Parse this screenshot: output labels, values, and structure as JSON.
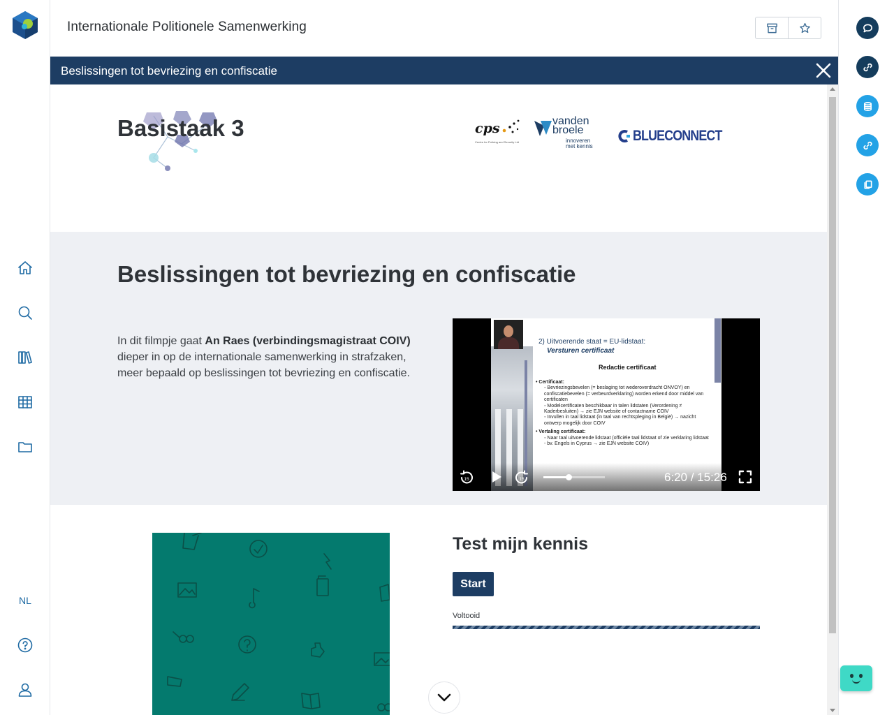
{
  "app": {
    "title": "Internationale Politionele Samenwerking"
  },
  "colors": {
    "navy": "#1d3d63",
    "accent_blue": "#1e6aa3",
    "right_rail_dark": "#143c5c",
    "right_rail_light": "#23a2e6",
    "teal": "#047a6e",
    "bot": "#3fd9c6"
  },
  "header": {
    "actions": [
      {
        "icon": "archive-icon"
      },
      {
        "icon": "star-icon"
      }
    ]
  },
  "left_nav": {
    "items": [
      {
        "icon": "home-icon"
      },
      {
        "icon": "search-icon"
      },
      {
        "icon": "library-icon"
      },
      {
        "icon": "grid-icon"
      },
      {
        "icon": "folder-icon"
      }
    ],
    "language": "NL",
    "bottom": [
      {
        "icon": "help-icon"
      },
      {
        "icon": "user-icon"
      }
    ]
  },
  "title_bar": {
    "text": "Beslissingen tot bevriezing en confiscatie"
  },
  "hero": {
    "heading": "Basistaak 3",
    "partners": {
      "cps": "cps",
      "cps_sub": "Centre for Policing and Security Ltd",
      "vdb_line1": "vanden",
      "vdb_line2": "broele",
      "vdb_tag1": "innoveren",
      "vdb_tag2": "met kennis",
      "blue_connect": "BLUECONNECT"
    }
  },
  "video_section": {
    "title": "Beslissingen tot bevriezing en confiscatie",
    "intro_before": "In dit filmpje gaat ",
    "intro_bold": "An Raes (verbindingsmagistraat COIV)",
    "intro_after": " dieper in op de internationale samenwerking in strafzaken, meer bepaald op beslissingen tot bevriezing en confiscatie.",
    "video": {
      "current_time": "6:20",
      "duration": "15:26",
      "progress": 0.41,
      "slide": {
        "heading": "2) Uitvoerende staat = EU-lidstaat:",
        "subheading": "Versturen certificaat",
        "section": "Redactie certificaat",
        "lines": [
          {
            "level": 1,
            "text": "•  Certificaat:"
          },
          {
            "level": 2,
            "text": "◦ Bevriezingsbevelen (= beslaging tot wederoverdracht ONVOY) en confiscatiebevelen (= verbeurdverklaring) worden erkend door middel van certificaten"
          },
          {
            "level": 2,
            "text": "◦ Modelcertificaten beschikbaar in talen lidstaten (Verordening ≠ Kaderbesluiten) → zie EJN website of contactname COIV"
          },
          {
            "level": 2,
            "text": "◦ Invullen in taal lidstaat (in taal van rechtspleging in België) → nazicht ontwerp mogelijk door COIV"
          },
          {
            "level": 1,
            "text": "•  Vertaling certificaat:"
          },
          {
            "level": 2,
            "text": "◦ Naar taal uitvoerende lidstaat (officiële taal lidstaat of zie verklaring lidstaat - bv. Engels in Cyprus → zie EJN website COIV)"
          }
        ]
      }
    }
  },
  "quiz": {
    "title": "Test mijn kennis",
    "start_label": "Start",
    "status_label": "Voltooid"
  },
  "right_rail": {
    "buttons": [
      {
        "icon": "chat-icon",
        "color": "#143c5c"
      },
      {
        "icon": "link-icon",
        "color": "#143c5c"
      },
      {
        "icon": "database-icon",
        "color": "#23a2e6"
      },
      {
        "icon": "link-icon",
        "color": "#23a2e6"
      },
      {
        "icon": "copy-icon",
        "color": "#23a2e6"
      }
    ]
  }
}
